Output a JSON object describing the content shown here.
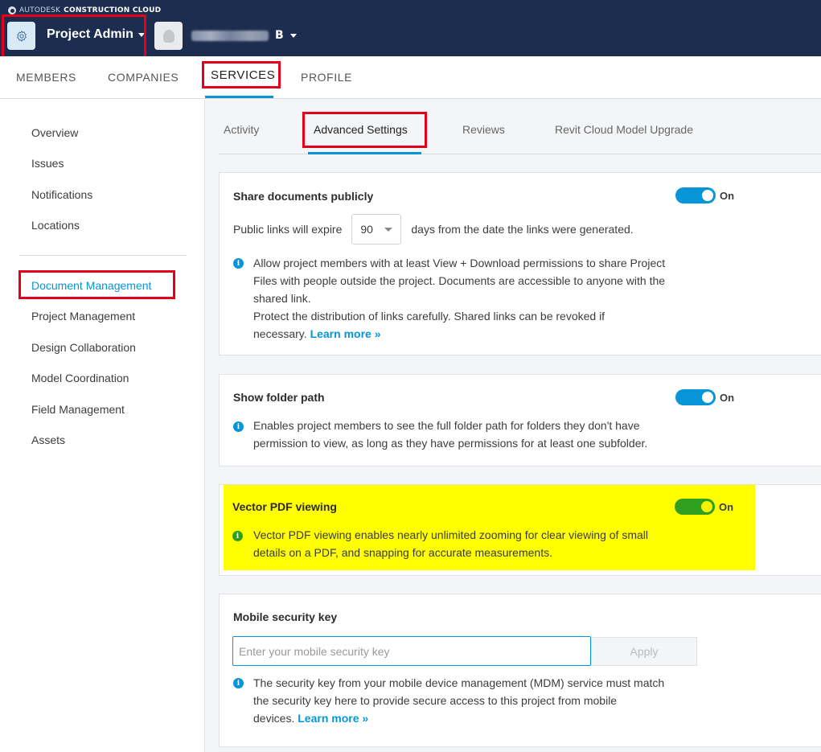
{
  "header": {
    "brand_prefix": "AUTODESK",
    "brand_product": "CONSTRUCTION CLOUD",
    "app_title": "Project Admin",
    "project_initial": "B"
  },
  "main_tabs": [
    {
      "label": "MEMBERS"
    },
    {
      "label": "COMPANIES"
    },
    {
      "label": "SERVICES",
      "active": true
    },
    {
      "label": "PROFILE"
    }
  ],
  "sidebar": {
    "group1": [
      "Overview",
      "Issues",
      "Notifications",
      "Locations"
    ],
    "group2": [
      "Document Management",
      "Project Management",
      "Design Collaboration",
      "Model Coordination",
      "Field Management",
      "Assets"
    ],
    "active": "Document Management"
  },
  "sub_tabs": [
    {
      "label": "Activity"
    },
    {
      "label": "Advanced Settings",
      "active": true
    },
    {
      "label": "Reviews"
    },
    {
      "label": "Revit Cloud Model Upgrade"
    }
  ],
  "share": {
    "title": "Share documents publicly",
    "toggle_label": "On",
    "expire_prefix": "Public links will expire",
    "expire_value": "90",
    "expire_suffix": "days from the date the links were generated.",
    "desc_line1": "Allow project members with at least View + Download permissions to share Project",
    "desc_line2": "Files with people outside the project. Documents are accessible to anyone with the",
    "desc_line3": "shared link.",
    "desc_line4": "Protect the distribution of links carefully. Shared links can be revoked if",
    "desc_line5": "necessary.",
    "learn_more": "Learn more »"
  },
  "folder": {
    "title": "Show folder path",
    "toggle_label": "On",
    "desc_line1": "Enables project members to see the full folder path for folders they don't have",
    "desc_line2": "permission to view, as long as they have permissions for at least one subfolder."
  },
  "vector": {
    "title": "Vector PDF viewing",
    "toggle_label": "On",
    "desc_line1": "Vector PDF viewing enables nearly unlimited zooming for clear viewing of small",
    "desc_line2": "details on a PDF, and snapping for accurate measurements."
  },
  "mobile": {
    "title": "Mobile security key",
    "placeholder": "Enter your mobile security key",
    "apply_label": "Apply",
    "desc_line1": "The security key from your mobile device management (MDM) service must match",
    "desc_line2": "the security key here to provide secure access to this project from mobile",
    "desc_line3": "devices.",
    "learn_more": "Learn more »"
  },
  "colors": {
    "header_bg": "#1c2d4f",
    "accent": "#0696d7",
    "annotation_red": "#e4001b",
    "highlight_yellow": "#ffff00",
    "toggle_green": "#2ea01d"
  }
}
